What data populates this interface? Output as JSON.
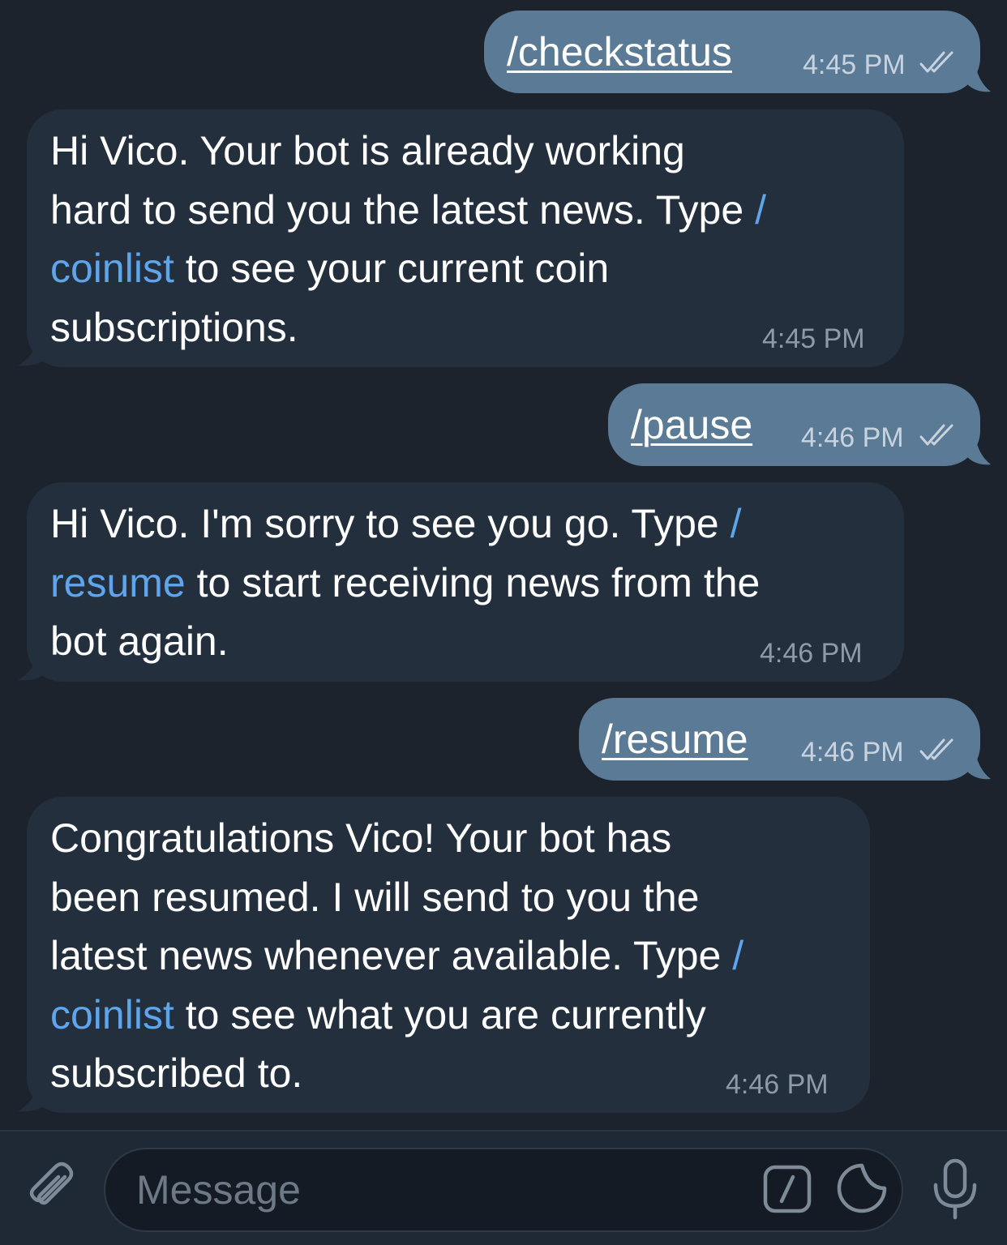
{
  "colors": {
    "background": "#1c232d",
    "outgoing_bubble": "#5b7a96",
    "incoming_bubble": "#232f3d",
    "link": "#5ea5ec",
    "composer_background": "#1f2835"
  },
  "messages": [
    {
      "direction": "outgoing",
      "text": "/checkstatus",
      "time": "4:45 PM",
      "status_icon": "double-check-icon"
    },
    {
      "direction": "incoming",
      "time": "4:45 PM",
      "lines": [
        {
          "before": "Hi Vico. Your bot is already working",
          "link": "",
          "after": ""
        },
        {
          "before": "hard to send you the latest news. Type ",
          "link": "/",
          "after": ""
        },
        {
          "before": "",
          "link": "coinlist",
          "after": " to see your current coin"
        },
        {
          "before": "subscriptions.",
          "link": "",
          "after": ""
        }
      ]
    },
    {
      "direction": "outgoing",
      "text": "/pause",
      "time": "4:46 PM",
      "status_icon": "double-check-icon"
    },
    {
      "direction": "incoming",
      "time": "4:46 PM",
      "lines": [
        {
          "before": "Hi Vico. I'm sorry to see you go. Type ",
          "link": "/",
          "after": ""
        },
        {
          "before": "",
          "link": "resume",
          "after": " to start receiving news from the"
        },
        {
          "before": "bot again.",
          "link": "",
          "after": ""
        }
      ]
    },
    {
      "direction": "outgoing",
      "text": "/resume",
      "time": "4:46 PM",
      "status_icon": "double-check-icon"
    },
    {
      "direction": "incoming",
      "time": "4:46 PM",
      "lines": [
        {
          "before": "Congratulations Vico! Your bot has",
          "link": "",
          "after": ""
        },
        {
          "before": "been resumed. I will send to you the",
          "link": "",
          "after": ""
        },
        {
          "before": "latest news whenever available. Type ",
          "link": "/",
          "after": ""
        },
        {
          "before": "",
          "link": "coinlist",
          "after": " to see what you are currently"
        },
        {
          "before": "subscribed to.",
          "link": "",
          "after": ""
        }
      ]
    }
  ],
  "composer": {
    "placeholder": "Message",
    "attach_icon": "paperclip-icon",
    "commands_icon": "slash-command-icon",
    "sticker_icon": "sticker-icon",
    "mic_icon": "microphone-icon"
  }
}
